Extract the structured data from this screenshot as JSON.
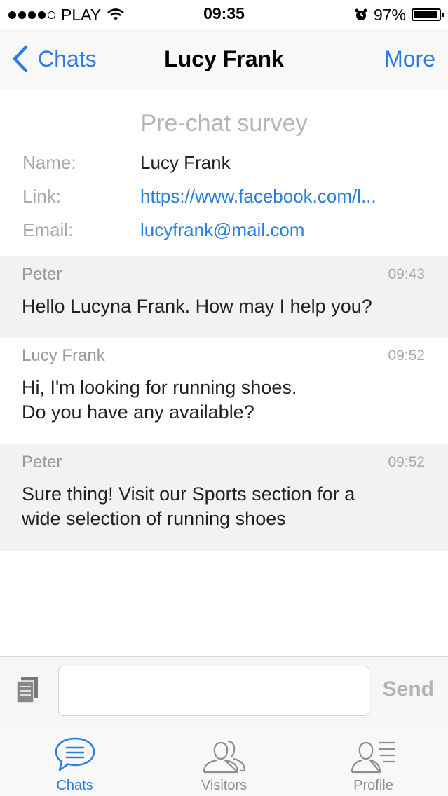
{
  "status_bar": {
    "carrier": "PLAY",
    "time": "09:35",
    "battery": "97%",
    "battery_level": 0.97,
    "signal_bars": 4
  },
  "nav": {
    "back_label": "Chats",
    "title": "Lucy Frank",
    "more_label": "More"
  },
  "survey": {
    "title": "Pre-chat survey",
    "fields": [
      {
        "label": "Name:",
        "value": "Lucy Frank"
      },
      {
        "label": "Link:",
        "value": "https://www.facebook.com/l..."
      },
      {
        "label": "Email:",
        "value": "lucyfrank@mail.com"
      }
    ]
  },
  "messages": [
    {
      "author": "Peter",
      "time": "09:43",
      "text": "Hello Lucyna Frank. How may I help you?"
    },
    {
      "author": "Lucy Frank",
      "time": "09:52",
      "text": "Hi, I'm looking for running shoes.\nDo you have any available?"
    },
    {
      "author": "Peter",
      "time": "09:52",
      "text": "Sure thing! Visit our Sports section for a\nwide selection of running shoes"
    }
  ],
  "composer": {
    "value": "",
    "placeholder": "",
    "send_label": "Send"
  },
  "tabs": [
    {
      "label": "Chats",
      "icon": "chat-bubble-icon",
      "active": true
    },
    {
      "label": "Visitors",
      "icon": "visitors-icon",
      "active": false
    },
    {
      "label": "Profile",
      "icon": "profile-icon",
      "active": false
    }
  ],
  "colors": {
    "accent": "#2b7de0",
    "muted": "#a9a9a9",
    "message_shade": "#f2f2f2"
  }
}
